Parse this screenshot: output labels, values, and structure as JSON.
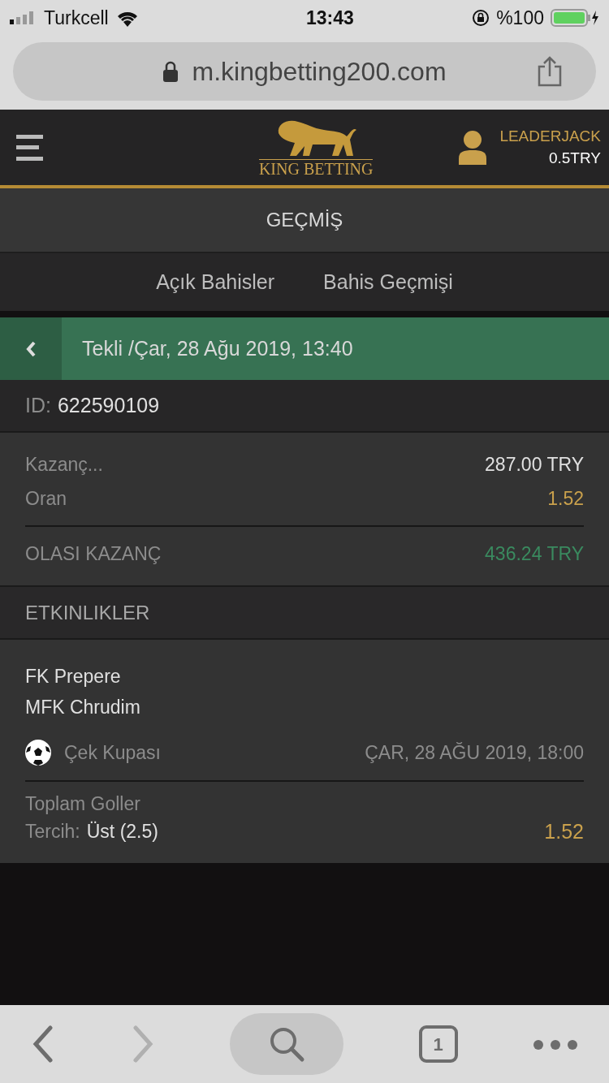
{
  "status_bar": {
    "carrier": "Turkcell",
    "time": "13:43",
    "battery": "%100"
  },
  "browser": {
    "url": "m.kingbetting200.com"
  },
  "header": {
    "logo_text": "KING BETTING",
    "username": "LEADERJACK",
    "balance": "0.5TRY"
  },
  "page_title": "GEÇMİŞ",
  "tabs": [
    {
      "label": "Açık Bahisler"
    },
    {
      "label": "Bahis Geçmişi"
    }
  ],
  "bet": {
    "title": "Tekli /Çar, 28 Ağu 2019, 13:40",
    "id_label": "ID:",
    "id": "622590109",
    "rows": [
      {
        "label": "Kazanç...",
        "value": "287.00 TRY",
        "kind": "plain"
      },
      {
        "label": "Oran",
        "value": "1.52",
        "kind": "odds"
      },
      {
        "label": "OLASI KAZANÇ",
        "value": "436.24 TRY",
        "kind": "win"
      }
    ]
  },
  "events_title": "ETKINLIKLER",
  "events": [
    {
      "home": "FK Prepere",
      "away": "MFK Chrudim",
      "competition": "Çek Kupası",
      "date": "ÇAR, 28 AĞU 2019, 18:00",
      "market": "Toplam Goller",
      "choice_label": "Tercih:",
      "choice": "Üst (2.5)",
      "odds": "1.52"
    }
  ],
  "toolbar": [
    {
      "kind": "back",
      "disabled": false
    },
    {
      "kind": "forward",
      "disabled": true
    },
    {
      "kind": "search",
      "disabled": false
    },
    {
      "kind": "tabs",
      "count": "1",
      "disabled": false
    },
    {
      "kind": "more",
      "disabled": false
    }
  ]
}
